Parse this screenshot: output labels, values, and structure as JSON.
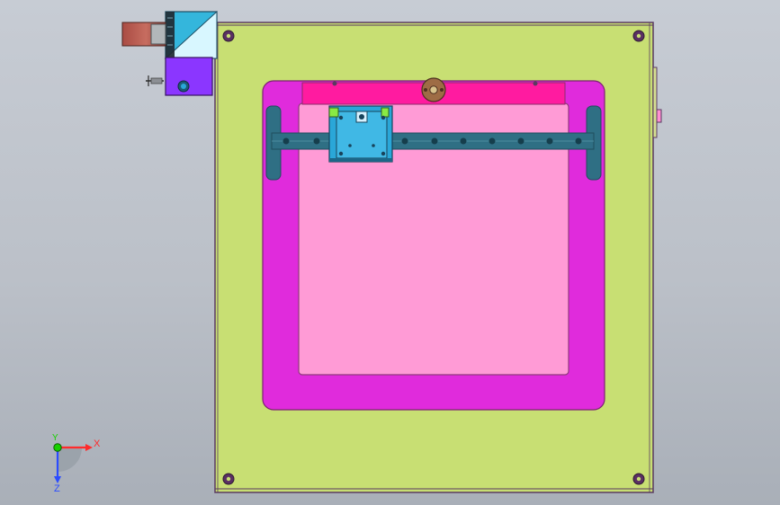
{
  "viewport": {
    "background_top": "#c6cbd3",
    "background_bottom": "#a9afb8"
  },
  "model": {
    "base_plate_color": "#c8df73",
    "outer_frame_color": "#e02bdc",
    "inner_panel_color": "#ff9bd6",
    "top_bar_color": "#ff1ba0",
    "rail_color": "#2f6f84",
    "carriage_color": "#2aa7d8",
    "motor_body_color": "#b75c50",
    "motor_mount_color": "#34b6dc",
    "motor_base_color": "#8b36ff",
    "edge_color": "#5a3a61"
  },
  "triad": {
    "x_label": "X",
    "y_label": "Y",
    "z_label": "Z",
    "x_color": "#ff2b2b",
    "y_color": "#18d000",
    "z_color": "#2b4cff"
  }
}
